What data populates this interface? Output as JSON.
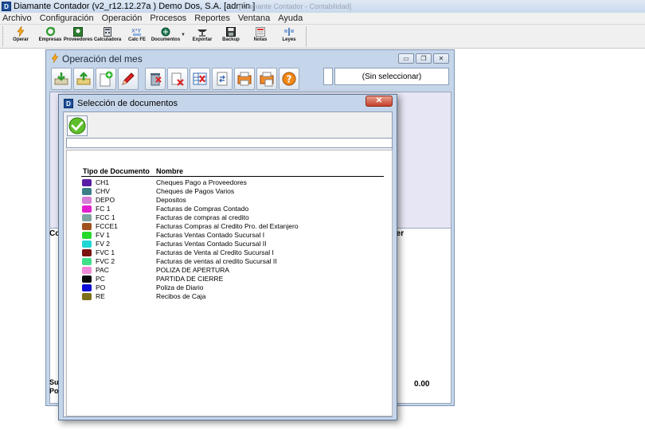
{
  "app": {
    "title": "Diamante Contador (v2_r12.12.27a ) Demo Dos, S.A.  [admin ]",
    "title_faded": "[Diamante Contador - Contabilidad]"
  },
  "menu": [
    "Archivo",
    "Configuración",
    "Operación",
    "Procesos",
    "Reportes",
    "Ventana",
    "Ayuda"
  ],
  "toolbar": [
    {
      "label": "Operar",
      "icon": "lightning-icon"
    },
    {
      "label": "Empresas",
      "icon": "refresh-icon"
    },
    {
      "label": "Proveedores",
      "icon": "provider-icon"
    },
    {
      "label": "Calculadora",
      "icon": "calculator-icon"
    },
    {
      "label": "Calc FE",
      "icon": "xy-icon"
    },
    {
      "label": "Documentos",
      "icon": "documents-icon"
    },
    {
      "label": "Exportar",
      "icon": "export-icon"
    },
    {
      "label": "Backup",
      "icon": "disk-icon"
    },
    {
      "label": "Notas",
      "icon": "notes-icon"
    },
    {
      "label": "Leyes",
      "icon": "scales-icon"
    }
  ],
  "op_window": {
    "title": "Operación del mes",
    "selector": "(Sin seleccionar)",
    "col_left": "Co",
    "col_right": "aber",
    "total_label_1": "Su",
    "total_label_2": "Po",
    "total_value": "0.00"
  },
  "dialog": {
    "title": "Selección de documentos",
    "close": "✕",
    "col_tipo": "Tipo de  Documento",
    "col_nombre": "Nombre",
    "rows": [
      {
        "code": "CH1",
        "name": "Cheques Pago a Proveedores",
        "color": "#5a1ea6"
      },
      {
        "code": "CHV",
        "name": "Cheques de Pagos Varios",
        "color": "#3d7f86"
      },
      {
        "code": "DEPO",
        "name": "Depositos",
        "color": "#d77fd6"
      },
      {
        "code": "FC 1",
        "name": "Facturas de Compras Contado",
        "color": "#e21fd0"
      },
      {
        "code": "FCC 1",
        "name": "Facturas de compras al credito",
        "color": "#7ea3a0"
      },
      {
        "code": "FCCE1",
        "name": "Facturas Compras al Credito Pro. del Extanjero",
        "color": "#a0521d"
      },
      {
        "code": "FV 1",
        "name": "Facturas Ventas Contado Sucursal I",
        "color": "#26d92a"
      },
      {
        "code": "FV 2",
        "name": "Facturas Ventas Contado Sucursal II",
        "color": "#1fd6d6"
      },
      {
        "code": "FVC 1",
        "name": "Facturas de Venta al Credito Sucursal I",
        "color": "#7a1212"
      },
      {
        "code": "FVC 2",
        "name": "Facturas de ventas al credito Sucursal II",
        "color": "#3ee08a"
      },
      {
        "code": "PAC",
        "name": "POLIZA DE APERTURA",
        "color": "#f08ad6"
      },
      {
        "code": "PC",
        "name": "PARTIDA DE CIERRE",
        "color": "#0a0a0a"
      },
      {
        "code": "PO",
        "name": "Poliza de Diario",
        "color": "#0d0dd6"
      },
      {
        "code": "RE",
        "name": "Recibos de Caja",
        "color": "#7e6f1a"
      }
    ]
  }
}
